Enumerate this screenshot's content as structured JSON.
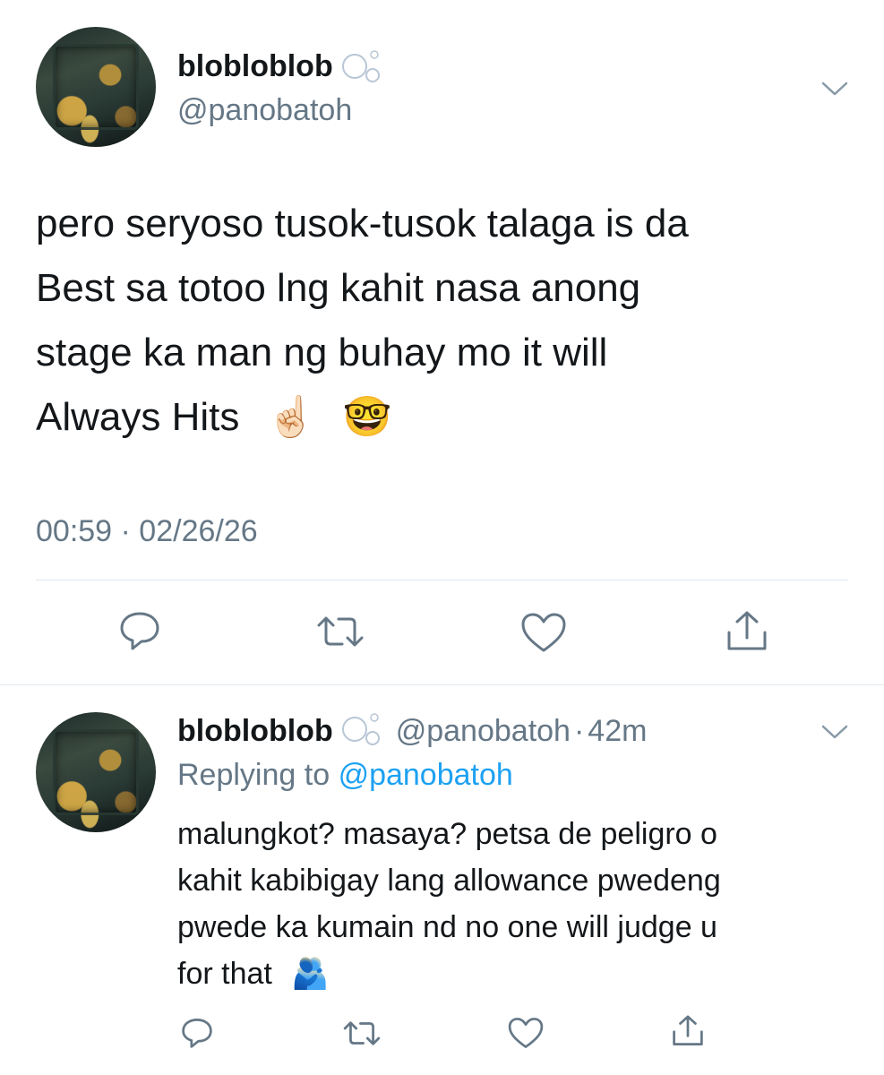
{
  "main_tweet": {
    "display_name": "blobloblob",
    "handle": "@panobatoh",
    "text_lines": [
      "pero seryoso tusok-tusok talaga is da",
      "Best sa totoo lng kahit nasa anong",
      "stage ka man ng buhay mo it will",
      "Always Hits"
    ],
    "emojis": [
      "☝🏻",
      "🤓"
    ],
    "timestamp": "00:59 · 02/26/26"
  },
  "reply_tweet": {
    "display_name": "blobloblob",
    "handle": "@panobatoh",
    "time_sep": "·",
    "time_ago": "42m",
    "replying_prefix": "Replying to",
    "replying_handle": "@panobatoh",
    "text_lines": [
      "malungkot? masaya? petsa de peligro o",
      "kahit kabibigay lang allowance pwedeng",
      "pwede ka kumain nd no one will judge u",
      "for that"
    ],
    "emoji": "🫂"
  },
  "icons": {
    "name_badge": "bubbles-icon",
    "menu": "chevron-down-icon",
    "reply": "reply-icon",
    "retweet": "retweet-icon",
    "like": "heart-icon",
    "share": "share-icon"
  },
  "colors": {
    "text": "#14171a",
    "secondary": "#657786",
    "link": "#1da1f2",
    "divider": "#e1e8ed"
  }
}
